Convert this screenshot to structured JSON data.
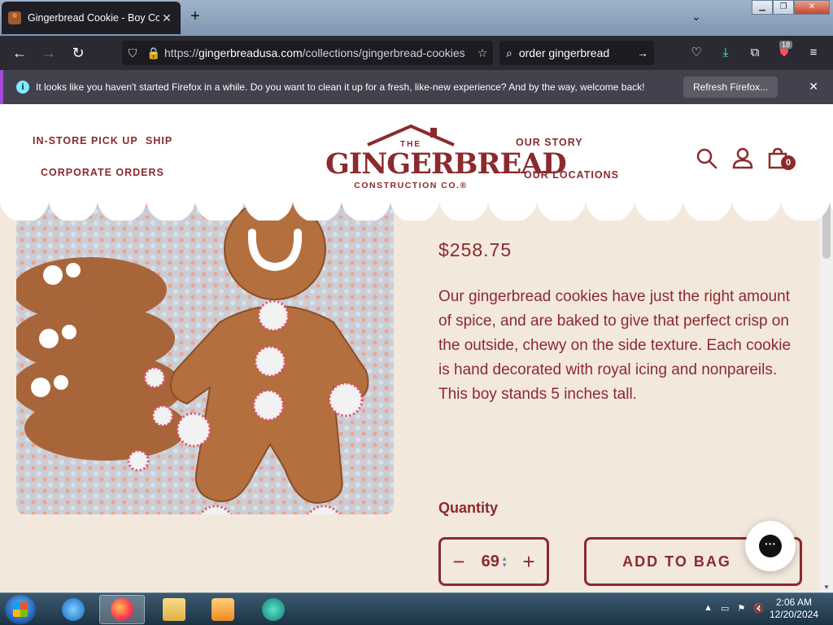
{
  "browser": {
    "tab_title": "Gingerbread Cookie - Boy Cookie",
    "tab_close": "✕",
    "new_tab": "+",
    "url_prefix": "https://",
    "url_domain": "gingerbreadusa.com",
    "url_path": "/collections/gingerbread-cookies",
    "search_query": "order gingerbread",
    "extension_badge": "18",
    "notification": {
      "message": "It looks like you haven't started Firefox in a while. Do you want to clean it up for a fresh, like-new experience? And by the way, welcome back!",
      "button": "Refresh Firefox...",
      "info_glyph": "i"
    }
  },
  "site": {
    "nav_left": [
      "IN-STORE PICK UP",
      "SHIP",
      "CORPORATE ORDERS"
    ],
    "nav_right": [
      "OUR STORY",
      "OUR LOCATIONS"
    ],
    "logo": {
      "top": "THE",
      "main": "GINGERBREAD",
      "sub": "CONSTRUCTION CO.®"
    },
    "cart_count": "0",
    "accent_color": "#8b2a2e"
  },
  "product": {
    "price": "$258.75",
    "description": "Our gingerbread cookies have just the right amount of spice, and are baked to give that perfect crisp on the outside, chewy on the side texture. Each cookie is hand decorated with royal icing and nonpareils. This boy stands 5 inches tall.",
    "quantity_label": "Quantity",
    "quantity_value": "69",
    "minus": "−",
    "plus": "+",
    "add_to_bag": "ADD TO BAG"
  },
  "taskbar": {
    "time": "2:06 AM",
    "date": "12/20/2024"
  }
}
